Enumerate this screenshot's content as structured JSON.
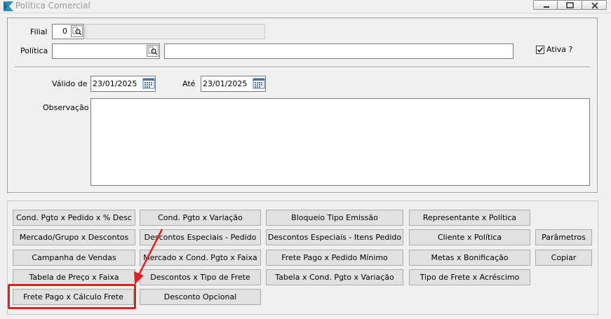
{
  "window": {
    "title": "Política Comercial",
    "controls": [
      "minimize-icon",
      "restore-icon",
      "close-icon"
    ]
  },
  "form": {
    "filial_label": "Filial",
    "filial_value": "0",
    "politica_label": "Política",
    "politica_code": "",
    "politica_desc": "",
    "ativa_label": "Ativa ?",
    "ativa_checked": true,
    "valido_de_label": "Válido de",
    "valido_de_value": "23/01/2025",
    "ate_label": "Até",
    "ate_value": "23/01/2025",
    "observacao_label": "Observação",
    "observacao_value": ""
  },
  "buttons": {
    "col1": [
      "Cond. Pgto x Pedido x % Desc",
      "Mercado/Grupo x Descontos",
      "Campanha de Vendas",
      "Tabela de Preço x Faixa",
      "Frete Pago x Cálculo Frete"
    ],
    "col2": [
      "Cond. Pgto x Variação",
      "Descontos Especiais - Pedido",
      "Mercado x Cond. Pgto x Faixa",
      "Descontos x Tipo de Frete",
      "Desconto Opcional"
    ],
    "col3": [
      "Bloqueio Tipo Emissão",
      "Descontos Especiais - Itens Pedido",
      "Frete Pago x Pedido Mínimo",
      "Tabela x  Cond. Pgto x Variação"
    ],
    "col4": [
      "Representante x Política",
      "Cliente x Política",
      "Metas x Bonificação",
      "Tipo de Frete x Acréscimo"
    ],
    "col5": [
      "Parâmetros",
      "Copiar"
    ]
  },
  "annotation": {
    "color": "#e32020",
    "highlighted_button": "Frete Pago x Cálculo Frete"
  }
}
